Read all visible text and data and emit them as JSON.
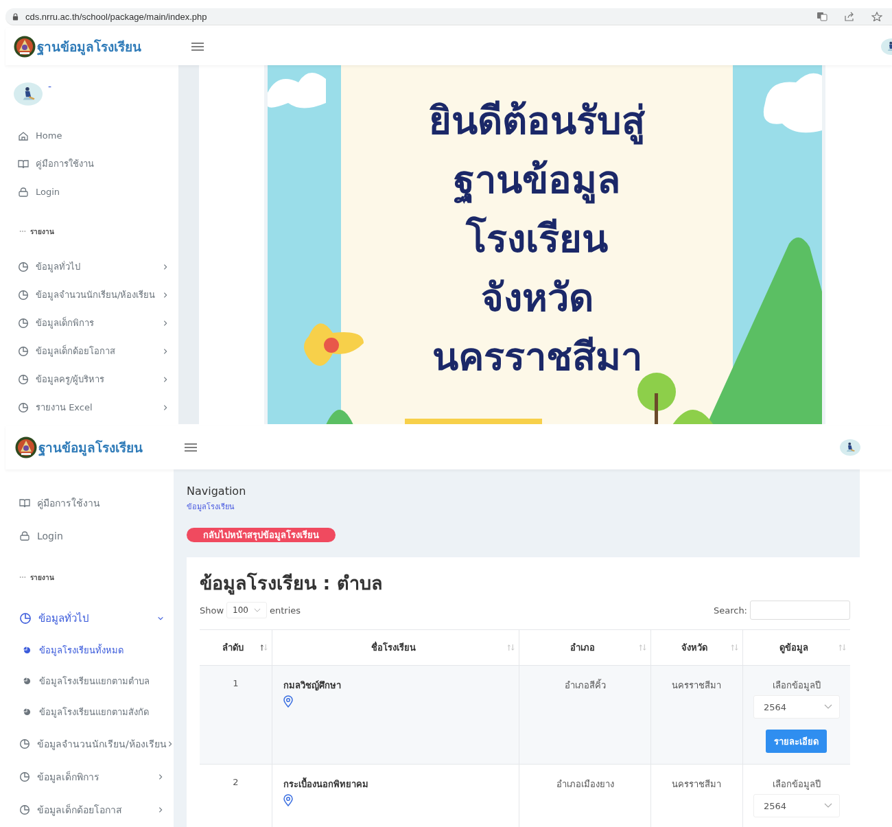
{
  "top": {
    "browser": {
      "url": "cds.nrru.ac.th/school/package/main/index.php"
    },
    "header": {
      "brand": "ฐานข้อมูลโรงเรียน"
    },
    "sidebar": {
      "user": "-",
      "items": [
        {
          "label": "Home"
        },
        {
          "label": "คู่มือการใช้งาน"
        },
        {
          "label": "Login"
        }
      ],
      "section": "รายงาน",
      "reports": [
        {
          "label": "ข้อมูลทั่วไป",
          "expanded": false
        },
        {
          "label": "ข้อมูลจำนวนนักเรียน/ห้องเรียน",
          "expanded": false
        },
        {
          "label": "ข้อมูลเด็กพิการ",
          "expanded": false
        },
        {
          "label": "ข้อมูลเด็กด้อยโอกาส",
          "expanded": false
        },
        {
          "label": "ข้อมูลครู/ผู้บริหาร",
          "expanded": false
        },
        {
          "label": "รายงาน Excel",
          "expanded": false
        }
      ]
    },
    "banner": {
      "lines": [
        "ยินดีต้อนรับสู่",
        "ฐานข้อมูล",
        "โรงเรียน",
        "จังหวัด",
        "นครราชสีมา"
      ]
    }
  },
  "bottom": {
    "header": {
      "brand": "ฐานข้อมูลโรงเรียน"
    },
    "sidebar": {
      "items": [
        {
          "label": "คู่มือการใช้งาน"
        },
        {
          "label": "Login"
        }
      ],
      "section": "รายงาน",
      "reports": [
        {
          "label": "ข้อมูลทั่วไป",
          "expanded": true,
          "selected": true,
          "children": [
            {
              "label": "ข้อมูลโรงเรียนทั้งหมด",
              "selected": true
            },
            {
              "label": "ข้อมูลโรงเรียนแยกตามตำบล",
              "selected": false
            },
            {
              "label": "ข้อมูลโรงเรียนแยกตามสังกัด",
              "selected": false
            }
          ]
        },
        {
          "label": "ข้อมูลจำนวนนักเรียน/ห้องเรียน",
          "expanded": false,
          "selected": false
        },
        {
          "label": "ข้อมูลเด็กพิการ",
          "expanded": false,
          "selected": false
        },
        {
          "label": "ข้อมูลเด็กด้อยโอกาส",
          "expanded": false,
          "selected": false
        }
      ]
    },
    "content": {
      "title": "Navigation",
      "breadcrumb": "ข้อมูลโรงเรียน",
      "back_button": "กลับไปหน้าสรุปข้อมูลโรงเรียน",
      "card_title": "ข้อมูลโรงเรียน : ตำบล",
      "show_label": "Show",
      "page_size": "100",
      "entries_label": "entries",
      "search_label": "Search:",
      "table": {
        "columns": [
          "ลำดับ",
          "ชื่อโรงเรียน",
          "อำเภอ",
          "จังหวัด",
          "ดูข้อมูล"
        ],
        "rows": [
          {
            "no": "1",
            "school": "กมลวิชญ์ศึกษา",
            "district": "อำเภอสีคิ้ว",
            "province": "นครราชสีมา",
            "select_label": "เลือกข้อมูลปี",
            "year": "2564",
            "button": "รายละเอียด"
          },
          {
            "no": "2",
            "school": "กระเบื้องนอกพิทยาคม",
            "district": "อำเภอเมืองยาง",
            "province": "นครราชสีมา",
            "select_label": "เลือกข้อมูลปี",
            "year": "2564"
          }
        ]
      }
    }
  }
}
